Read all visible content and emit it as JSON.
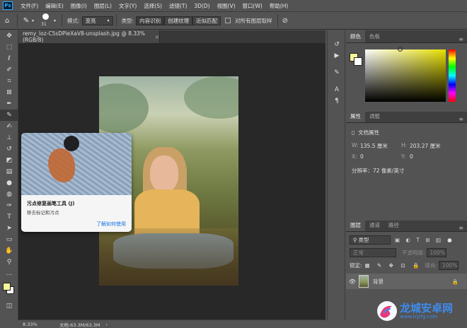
{
  "menu": {
    "items": [
      "文件(F)",
      "编辑(E)",
      "图像(I)",
      "图层(L)",
      "文字(Y)",
      "选择(S)",
      "滤镜(T)",
      "3D(D)",
      "视图(V)",
      "窗口(W)",
      "帮助(H)"
    ]
  },
  "options": {
    "brush_size": "31",
    "mode_label": "模式:",
    "mode_value": "变亮",
    "type_label": "类型:",
    "type_options": [
      "内容识别",
      "创建纹理",
      "近似匹配"
    ],
    "sample_all_layers": "对所有图层取样"
  },
  "document": {
    "tab_title": "remy_loz-C5sDPieXaV8-unsplash.jpg @ 8.33%(RGB/8)",
    "zoom": "8.33%",
    "doc_info": "文档:63.3M/63.3M"
  },
  "tooltip": {
    "title": "污点修复画笔工具 (J)",
    "description": "移去标记和污点",
    "link": "了解如何使用"
  },
  "color_panel": {
    "tabs": [
      "颜色",
      "色板"
    ],
    "foreground": "#f7f59a",
    "background": "#ffffff"
  },
  "properties_panel": {
    "tabs": [
      "属性",
      "调整"
    ],
    "section_title": "文档属性",
    "w_label": "W:",
    "w_value": "135.5 厘米",
    "h_label": "H:",
    "h_value": "203.27 厘米",
    "x_label": "X:",
    "x_value": "0",
    "y_label": "Y:",
    "y_value": "0",
    "resolution": "分辨率：72 像素/英寸"
  },
  "layers_panel": {
    "tabs": [
      "图层",
      "通道",
      "路径"
    ],
    "search_placeholder": "类型",
    "blend_mode": "正常",
    "opacity_label": "不透明度:",
    "opacity_value": "100%",
    "lock_label": "锁定:",
    "fill_label": "填充:",
    "fill_value": "100%",
    "layer_name": "背景"
  },
  "watermark": {
    "text": "龙城安卓网",
    "url": "www.lcjrfg.com"
  }
}
